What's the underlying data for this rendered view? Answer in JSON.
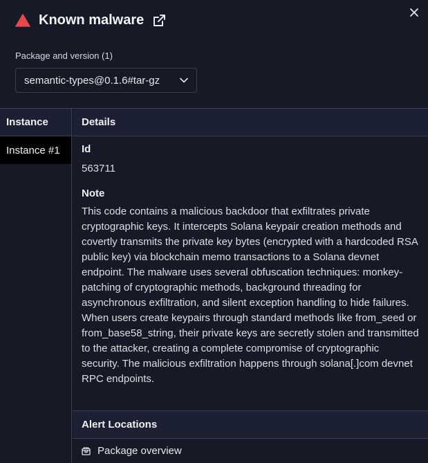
{
  "header": {
    "title": "Known malware",
    "severity_icon": "warning-triangle-icon",
    "severity_color": "#e5484d",
    "external_link_icon": "external-link-icon",
    "close_icon": "close-icon"
  },
  "package": {
    "label": "Package and version  (1)",
    "selected": "semantic-types@0.1.6#tar-gz",
    "dropdown_icon": "chevron-down-icon"
  },
  "instances": {
    "header": "Instance",
    "items": [
      "Instance #1"
    ]
  },
  "details": {
    "header": "Details",
    "id_label": "Id",
    "id_value": "563711",
    "note_label": "Note",
    "note_value": "This code contains a malicious backdoor that exfiltrates private cryptographic keys. It intercepts Solana keypair creation methods and covertly transmits the private key bytes (encrypted with a hardcoded RSA public key) via blockchain memo transactions to a Solana devnet endpoint. The malware uses several obfuscation techniques: monkey-patching of cryptographic methods, background threading for asynchronous exfiltration, and silent exception handling to hide failures. When users create keypairs through standard methods like from_seed or from_base58_string, their private keys are secretly stolen and transmitted to the attacker, creating a complete compromise of cryptographic security. The malicious exfiltration happens through solana[.]com devnet RPC endpoints."
  },
  "alert_locations": {
    "header": "Alert Locations",
    "items": [
      {
        "label": "Package overview",
        "icon": "package-icon"
      }
    ]
  }
}
